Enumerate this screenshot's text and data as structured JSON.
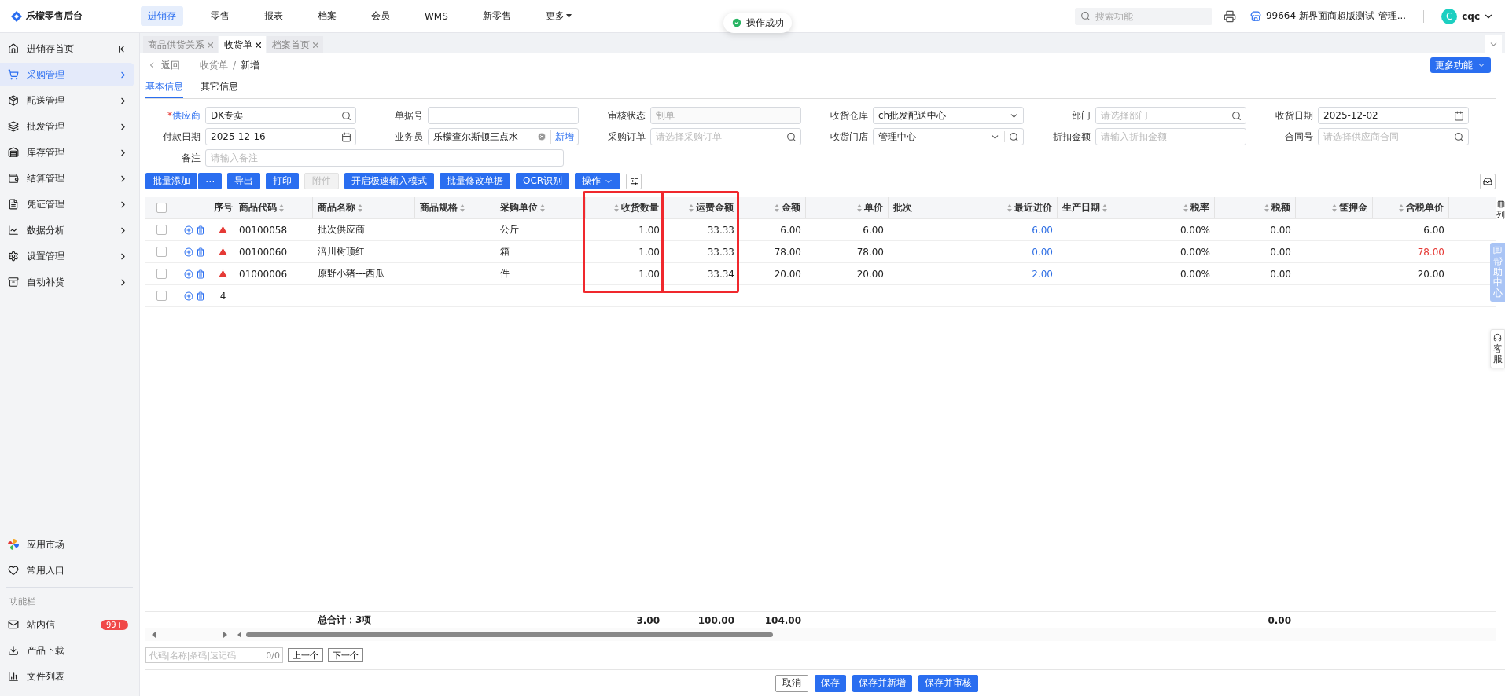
{
  "app": {
    "title": "乐檬零售后台"
  },
  "nav": [
    {
      "label": "进销存",
      "selected": true,
      "dropdown": false
    },
    {
      "label": "零售",
      "selected": false,
      "dropdown": false
    },
    {
      "label": "报表",
      "selected": false,
      "dropdown": false
    },
    {
      "label": "档案",
      "selected": false,
      "dropdown": false
    },
    {
      "label": "会员",
      "selected": false,
      "dropdown": false
    },
    {
      "label": "WMS",
      "selected": false,
      "dropdown": false
    },
    {
      "label": "新零售",
      "selected": false,
      "dropdown": false
    },
    {
      "label": "更多",
      "selected": false,
      "dropdown": true
    }
  ],
  "toast": {
    "text": "操作成功"
  },
  "topbar": {
    "search_placeholder": "搜索功能",
    "store": "99664-新界面商超版测试-管理...",
    "user": {
      "initial": "C",
      "name": "cqc"
    }
  },
  "sidebar": {
    "items": [
      {
        "label": "进销存首页",
        "selected": false,
        "expandable": false
      },
      {
        "label": "采购管理",
        "selected": true,
        "expandable": true
      },
      {
        "label": "配送管理",
        "selected": false,
        "expandable": true
      },
      {
        "label": "批发管理",
        "selected": false,
        "expandable": true
      },
      {
        "label": "库存管理",
        "selected": false,
        "expandable": true
      },
      {
        "label": "结算管理",
        "selected": false,
        "expandable": true
      },
      {
        "label": "凭证管理",
        "selected": false,
        "expandable": true
      },
      {
        "label": "数据分析",
        "selected": false,
        "expandable": true
      },
      {
        "label": "设置管理",
        "selected": false,
        "expandable": true
      },
      {
        "label": "自动补货",
        "selected": false,
        "expandable": true
      }
    ],
    "bottom_items": [
      {
        "label": "应用市场"
      },
      {
        "label": "常用入口"
      }
    ],
    "section_title": "功能栏",
    "tool_items": [
      {
        "label": "站内信",
        "badge": "99+"
      },
      {
        "label": "产品下载"
      },
      {
        "label": "文件列表"
      }
    ]
  },
  "tabs": [
    {
      "label": "商品供货关系",
      "selected": false
    },
    {
      "label": "收货单",
      "selected": true
    },
    {
      "label": "档案首页",
      "selected": false
    }
  ],
  "breadcrumb": {
    "back": "返回",
    "path": "收货单",
    "separator": "/",
    "current": "新增"
  },
  "more_button": "更多功能",
  "subtabs": [
    {
      "label": "基本信息",
      "selected": true
    },
    {
      "label": "其它信息",
      "selected": false
    }
  ],
  "form": [
    {
      "label": "供应商",
      "mark": "*",
      "kind": "search",
      "value": "DK专卖"
    },
    {
      "label": "单据号",
      "kind": "text"
    },
    {
      "label": "审核状态",
      "kind": "text",
      "value": "制单",
      "disabled": true
    },
    {
      "label": "收货仓库",
      "kind": "select",
      "value": "ch批发配送中心"
    },
    {
      "label": "部门",
      "kind": "search",
      "placeholder": "请选择部门"
    },
    {
      "label": "收货日期",
      "kind": "date",
      "value": "2025-12-02"
    },
    {
      "label": "付款日期",
      "kind": "date",
      "value": "2025-12-16"
    },
    {
      "label": "业务员",
      "kind": "person",
      "value": "乐檬查尔斯顿三点水",
      "action": "新增"
    },
    {
      "label": "采购订单",
      "kind": "search",
      "placeholder": "请选择采购订单"
    },
    {
      "label": "收货门店",
      "kind": "select_search",
      "value": "管理中心"
    },
    {
      "label": "折扣金额",
      "kind": "text",
      "placeholder": "请输入折扣金额"
    },
    {
      "label": "合同号",
      "kind": "search",
      "placeholder": "请选择供应商合同"
    },
    {
      "label": "备注",
      "kind": "wide",
      "placeholder": "请输入备注"
    }
  ],
  "toolbar": [
    {
      "label": "批量添加",
      "kind": "split",
      "extra": "⋯",
      "disabled": false
    },
    {
      "label": "导出",
      "kind": "button",
      "disabled": false
    },
    {
      "label": "打印",
      "kind": "button",
      "disabled": false
    },
    {
      "label": "附件",
      "kind": "button",
      "disabled": true
    },
    {
      "label": "开启极速输入模式",
      "kind": "button",
      "disabled": false
    },
    {
      "label": "批量修改单据",
      "kind": "button",
      "disabled": false
    },
    {
      "label": "OCR识别",
      "kind": "button",
      "disabled": false
    },
    {
      "label": "操作",
      "kind": "dropdown",
      "disabled": false
    }
  ],
  "table": {
    "all_checked": false,
    "seq_header": "序号",
    "column_picker": "列",
    "columns": [
      {
        "label": "商品代码",
        "numeric": false,
        "sortable": true,
        "highlighted": false
      },
      {
        "label": "商品名称",
        "numeric": false,
        "sortable": true,
        "highlighted": false
      },
      {
        "label": "商品规格",
        "numeric": false,
        "sortable": true,
        "highlighted": false
      },
      {
        "label": "采购单位",
        "numeric": false,
        "sortable": true,
        "highlighted": false
      },
      {
        "label": "收货数量",
        "numeric": true,
        "sortable": true,
        "highlighted": true
      },
      {
        "label": "运费金额",
        "numeric": true,
        "sortable": true,
        "highlighted": true
      },
      {
        "label": "金额",
        "numeric": true,
        "sortable": true,
        "highlighted": false
      },
      {
        "label": "单价",
        "numeric": true,
        "sortable": true,
        "highlighted": false
      },
      {
        "label": "批次",
        "sortable": false,
        "highlighted": false
      },
      {
        "label": "最近进价",
        "numeric": true,
        "sortable": true,
        "highlighted": false
      },
      {
        "label": "生产日期",
        "numeric": false,
        "sortable": true,
        "highlighted": false
      },
      {
        "label": "税率",
        "numeric": true,
        "sortable": true,
        "highlighted": false
      },
      {
        "label": "税额",
        "numeric": true,
        "sortable": true,
        "highlighted": false
      },
      {
        "label": "筐押金",
        "numeric": true,
        "sortable": true,
        "highlighted": false
      },
      {
        "label": "含税单价",
        "numeric": true,
        "sortable": true,
        "highlighted": false
      }
    ],
    "rows": [
      {
        "warning": true,
        "checked": false,
        "code": "00100058",
        "name": "批次供应商",
        "unit": "公斤",
        "qty": "1.00",
        "freight": "33.33",
        "amount": "6.00",
        "price": "6.00",
        "last_price": {
          "text": "6.00",
          "color": "#2f6fe4"
        },
        "tax_rate": "0.00%",
        "tax": "0.00",
        "tax_price": {
          "text": "6.00",
          "color": "#222222"
        }
      },
      {
        "warning": true,
        "checked": false,
        "code": "00100060",
        "name": "涪川树顶红",
        "unit": "箱",
        "qty": "1.00",
        "freight": "33.33",
        "amount": "78.00",
        "price": "78.00",
        "last_price": {
          "text": "0.00",
          "color": "#2f6fe4"
        },
        "tax_rate": "0.00%",
        "tax": "0.00",
        "tax_price": {
          "text": "78.00",
          "color": "#e53935"
        }
      },
      {
        "warning": true,
        "checked": false,
        "code": "01000006",
        "name": "原野小猪---西瓜",
        "unit": "件",
        "qty": "1.00",
        "freight": "33.34",
        "amount": "20.00",
        "price": "20.00",
        "last_price": {
          "text": "2.00",
          "color": "#2f6fe4"
        },
        "tax_rate": "0.00%",
        "tax": "0.00",
        "tax_price": {
          "text": "20.00",
          "color": "#222222"
        }
      },
      {
        "warning": false,
        "checked": false,
        "seq": "4"
      }
    ],
    "totals": {
      "label": "总合计：3项",
      "qty": "3.00",
      "freight": "100.00",
      "amount": "104.00",
      "tax": "0.00"
    }
  },
  "finder": {
    "placeholder": "代码|名称|条码|速记码",
    "count": "0/0",
    "prev": "上一个",
    "next": "下一个"
  },
  "footer": [
    {
      "label": "取消",
      "primary": false
    },
    {
      "label": "保存",
      "primary": true
    },
    {
      "label": "保存并新增",
      "primary": true
    },
    {
      "label": "保存并审核",
      "primary": true
    }
  ],
  "side_panels": [
    {
      "label": "帮助中心",
      "kind": "help"
    },
    {
      "label": "客服",
      "kind": "service"
    }
  ]
}
